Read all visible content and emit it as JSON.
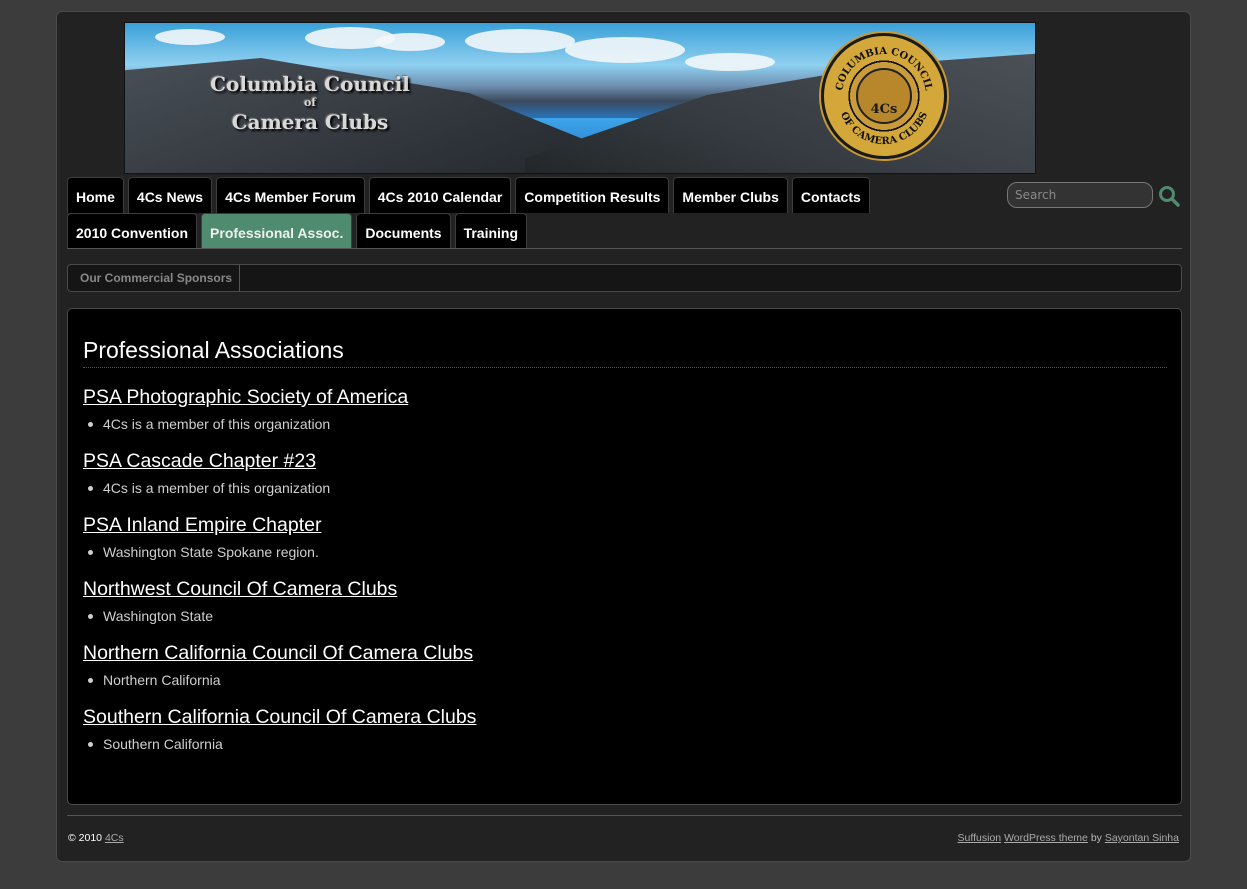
{
  "banner": {
    "title_line1": "Columbia Council",
    "title_of": "of",
    "title_line2": "Camera Clubs",
    "seal_center": "4Cs",
    "seal_ring_top": "COLUMBIA COUNCIL",
    "seal_ring_bottom": "OF CAMERA CLUBS"
  },
  "nav": {
    "row1": [
      "Home",
      "4Cs News",
      "4Cs Member Forum",
      "4Cs 2010 Calendar",
      "Competition Results",
      "Member Clubs",
      "Contacts"
    ],
    "row2": [
      "2010 Convention",
      "Professional Assoc.",
      "Documents",
      "Training"
    ],
    "active": "Professional Assoc.",
    "active_color": "#4f8b6e"
  },
  "search": {
    "placeholder": "Search",
    "icon": "search-icon",
    "icon_color": "#4f8b6e"
  },
  "subnav": {
    "items": [
      "Our Commercial Sponsors"
    ]
  },
  "content": {
    "page_title": "Professional Associations",
    "associations": [
      {
        "name": "PSA Photographic Society of America",
        "note": "4Cs is a member of this organization"
      },
      {
        "name": "PSA Cascade Chapter #23",
        "note": "4Cs is a member of this organization"
      },
      {
        "name": "PSA Inland Empire Chapter",
        "note": "Washington State Spokane region."
      },
      {
        "name": "Northwest Council Of Camera Clubs",
        "note": "Washington State"
      },
      {
        "name": "Northern California Council Of Camera Clubs",
        "note": "Northern California"
      },
      {
        "name": "Southern California Council Of Camera Clubs",
        "note": "Southern California"
      }
    ]
  },
  "footer": {
    "copyright": "© 2010",
    "site_link": "4Cs",
    "theme_link": "Suffusion",
    "wp_link": "WordPress theme",
    "by_text": "by",
    "author_link": "Sayontan Sinha"
  }
}
